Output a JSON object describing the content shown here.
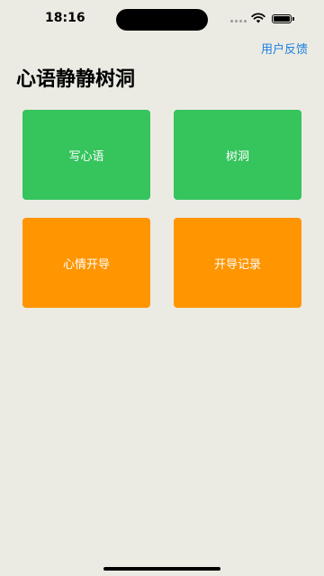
{
  "status_bar": {
    "time": "18:16",
    "icons": [
      "signal-icon",
      "wifi-icon",
      "battery-icon"
    ]
  },
  "header": {
    "feedback_label": "用户反馈",
    "title": "心语静静树洞"
  },
  "tiles": [
    {
      "label": "写心语",
      "color": "#36c45d"
    },
    {
      "label": "树洞",
      "color": "#36c45d"
    },
    {
      "label": "心情开导",
      "color": "#ff9500"
    },
    {
      "label": "开导记录",
      "color": "#ff9500"
    }
  ],
  "colors": {
    "background": "#ebebe3",
    "accent_link": "#1b7fe0",
    "green": "#36c45d",
    "orange": "#ff9500"
  }
}
